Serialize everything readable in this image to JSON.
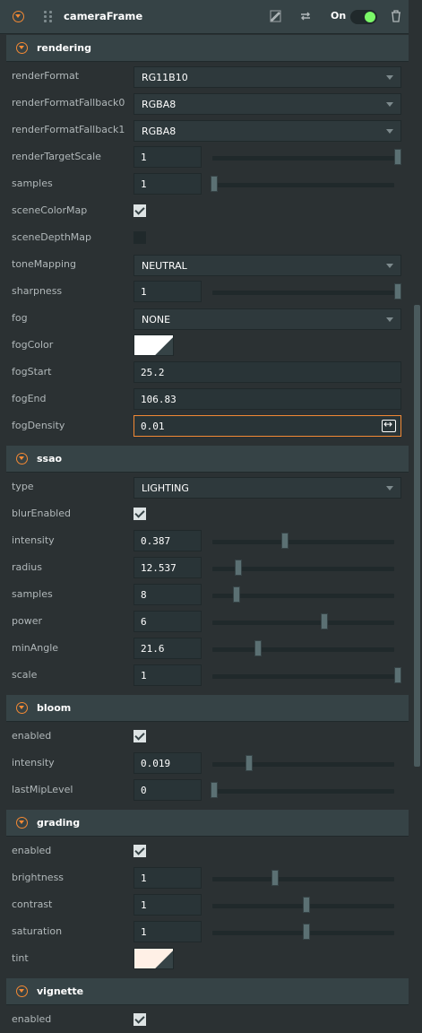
{
  "component": {
    "title": "cameraFrame",
    "enabled_label": "On",
    "icons": [
      "collapse-icon",
      "drag-handle-icon",
      "edit-icon",
      "swap-icon",
      "trash-icon"
    ],
    "accent_color": "#f38934",
    "toggle_color": "#7bf968"
  },
  "rendering": {
    "title": "rendering",
    "renderFormat_label": "renderFormat",
    "renderFormat_value": "RG11B10",
    "renderFormatFallback0_label": "renderFormatFallback0",
    "renderFormatFallback0_value": "RGBA8",
    "renderFormatFallback1_label": "renderFormatFallback1",
    "renderFormatFallback1_value": "RGBA8",
    "renderTargetScale_label": "renderTargetScale",
    "renderTargetScale_value": "1",
    "renderTargetScale_level": 1.0,
    "samples_label": "samples",
    "samples_value": "1",
    "samples_level": 0.0,
    "sceneColorMap_label": "sceneColorMap",
    "sceneColorMap_checked": true,
    "sceneDepthMap_label": "sceneDepthMap",
    "sceneDepthMap_checked": false,
    "toneMapping_label": "toneMapping",
    "toneMapping_value": "NEUTRAL",
    "sharpness_label": "sharpness",
    "sharpness_value": "1",
    "sharpness_level": 1.0,
    "fog_label": "fog",
    "fog_value": "NONE",
    "fogColor_label": "fogColor",
    "fogColor_value": "#ffffff",
    "fogStart_label": "fogStart",
    "fogStart_value": "25.2",
    "fogEnd_label": "fogEnd",
    "fogEnd_value": "106.83",
    "fogDensity_label": "fogDensity",
    "fogDensity_value": "0.01"
  },
  "ssao": {
    "title": "ssao",
    "type_label": "type",
    "type_value": "LIGHTING",
    "blurEnabled_label": "blurEnabled",
    "blurEnabled_checked": true,
    "intensity_label": "intensity",
    "intensity_value": "0.387",
    "intensity_level": 0.387,
    "radius_label": "radius",
    "radius_value": "12.537",
    "radius_level": 0.13,
    "samples_label": "samples",
    "samples_value": "8",
    "samples_level": 0.12,
    "power_label": "power",
    "power_value": "6",
    "power_level": 0.6,
    "minAngle_label": "minAngle",
    "minAngle_value": "21.6",
    "minAngle_level": 0.24,
    "scale_label": "scale",
    "scale_value": "1",
    "scale_level": 1.0
  },
  "bloom": {
    "title": "bloom",
    "enabled_label": "enabled",
    "enabled_checked": true,
    "intensity_label": "intensity",
    "intensity_value": "0.019",
    "intensity_level": 0.19,
    "lastMipLevel_label": "lastMipLevel",
    "lastMipLevel_value": "0",
    "lastMipLevel_level": 0.0
  },
  "grading": {
    "title": "grading",
    "enabled_label": "enabled",
    "enabled_checked": true,
    "brightness_label": "brightness",
    "brightness_value": "1",
    "brightness_level": 0.33,
    "contrast_label": "contrast",
    "contrast_value": "1",
    "contrast_level": 0.5,
    "saturation_label": "saturation",
    "saturation_value": "1",
    "saturation_level": 0.5,
    "tint_label": "tint",
    "tint_value": "#fff0e6"
  },
  "vignette": {
    "title": "vignette",
    "enabled_label": "enabled",
    "enabled_checked": true
  }
}
